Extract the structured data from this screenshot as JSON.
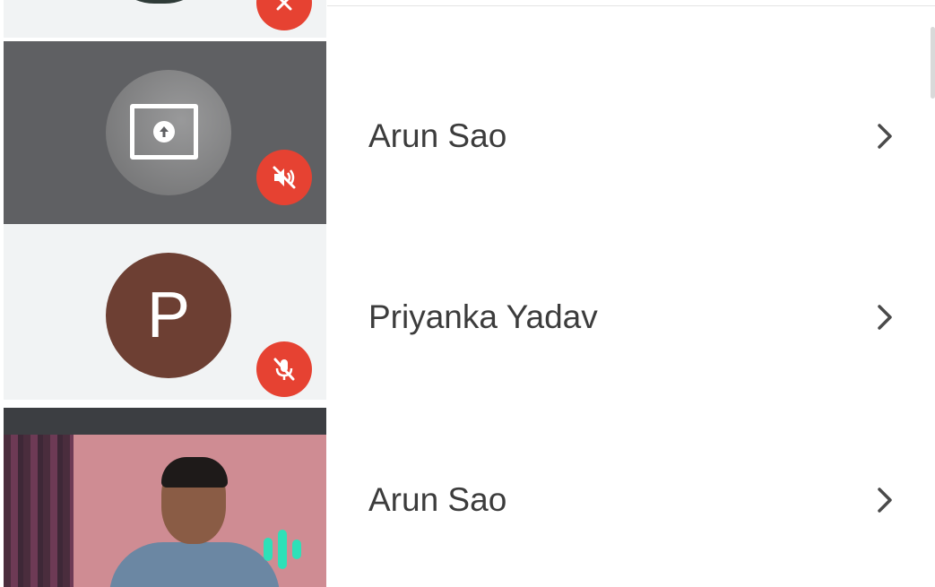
{
  "participants": [
    {
      "name": "Arun Sao",
      "tile": "presenting",
      "mic": "muted",
      "icons": [
        "present-screen-icon",
        "volume-off-icon",
        "chevron-right-icon"
      ]
    },
    {
      "name": "Priyanka Yadav",
      "tile": "initial",
      "initial": "P",
      "avatar_color": "#6d3f33",
      "mic": "muted",
      "icons": [
        "mic-off-icon",
        "chevron-right-icon"
      ]
    },
    {
      "name": "Arun Sao",
      "tile": "video",
      "mic": "speaking",
      "icons": [
        "speaking-icon",
        "chevron-right-icon"
      ]
    }
  ],
  "colors": {
    "mute_badge": "#e64232",
    "speaking": "#2ee0b8",
    "tile_bg": "#f1f3f4",
    "name_text": "#3c3c3c",
    "tab_indicator": "#1f6b5e"
  }
}
